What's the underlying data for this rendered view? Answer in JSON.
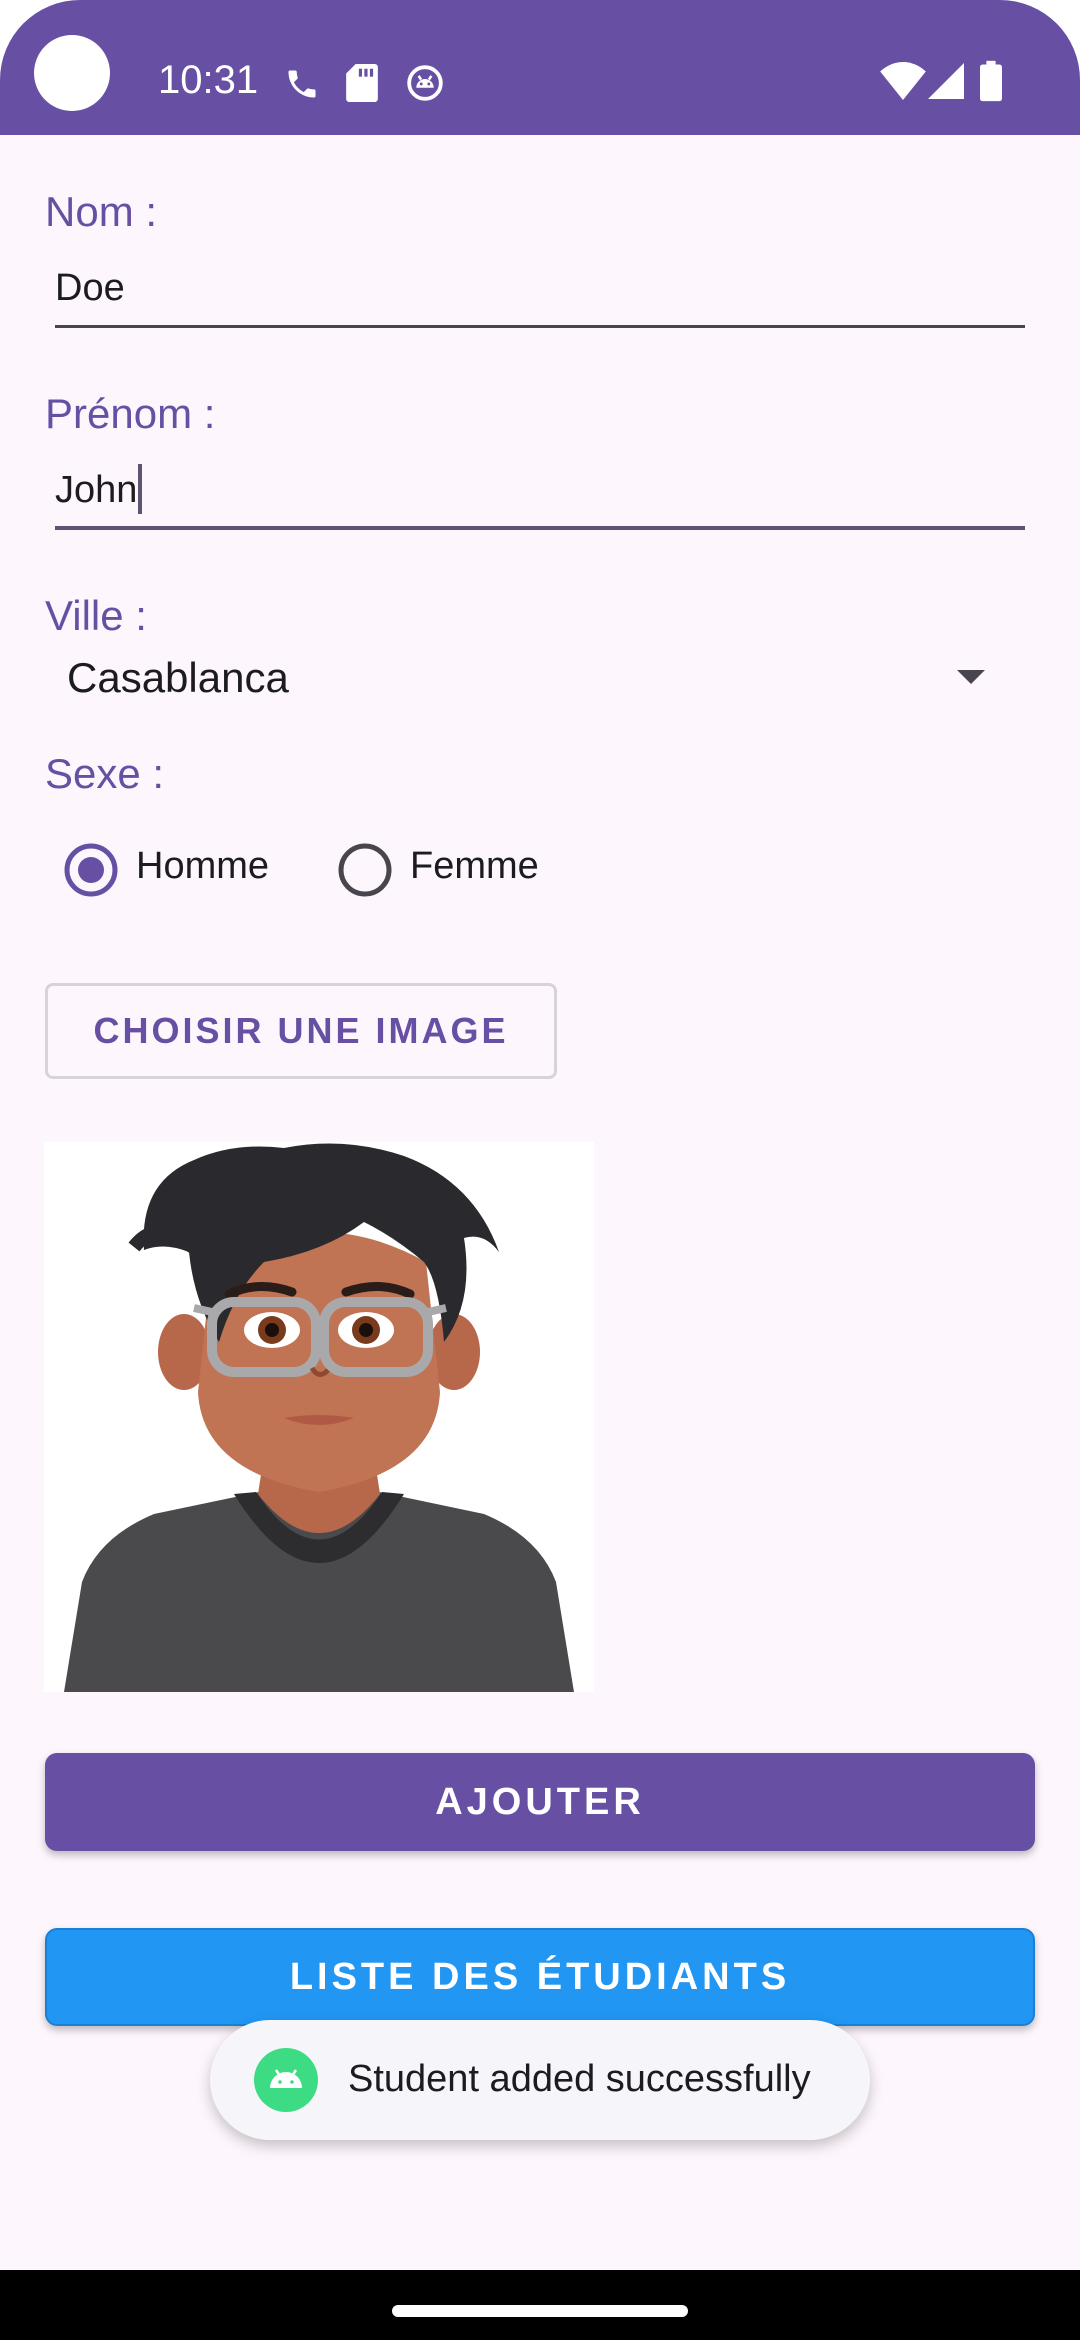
{
  "status_bar": {
    "time": "10:31",
    "left_icons": [
      "phone-icon",
      "sd-card-icon",
      "debug-icon"
    ],
    "right_icons": [
      "wifi-icon",
      "cell-signal-icon",
      "battery-icon"
    ],
    "background_color": "#6750a4"
  },
  "form": {
    "nom_label": "Nom :",
    "nom_value": "Doe",
    "prenom_label": "Prénom :",
    "prenom_value": "John",
    "ville_label": "Ville :",
    "ville_value": "Casablanca",
    "sexe_label": "Sexe :",
    "sexe_options": [
      {
        "label": "Homme",
        "selected": true
      },
      {
        "label": "Femme",
        "selected": false
      }
    ]
  },
  "buttons": {
    "choose_image": "CHOISIR UNE IMAGE",
    "add": "AJOUTER",
    "student_list": "LISTE DES ÉTUDIANTS"
  },
  "toast": {
    "message": "Student added successfully"
  },
  "colors": {
    "primary": "#6750a4",
    "list_button": "#2196f3",
    "background": "#fdf6fc"
  }
}
